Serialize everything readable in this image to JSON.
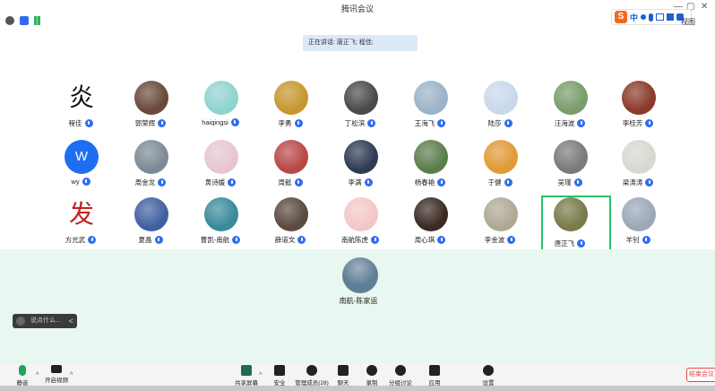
{
  "window": {
    "title": "腾讯会议",
    "controls": [
      "—",
      "▢",
      "✕"
    ]
  },
  "ime": {
    "logo": "S",
    "lang": "中",
    "tail": "视图"
  },
  "speaking_banner": "正在讲话: 唐正飞; 程佳;",
  "participants": [
    {
      "name": "程佳",
      "avatar": "calligraphy",
      "glyph": "炎",
      "color": "#ffffff"
    },
    {
      "name": "郭荣辉",
      "avatar": "photo",
      "color": "#6a4a3a"
    },
    {
      "name": "haiqingsi",
      "avatar": "photo",
      "color": "#8fd3d0"
    },
    {
      "name": "李勇",
      "avatar": "photo",
      "color": "#c7962f"
    },
    {
      "name": "丁松滨",
      "avatar": "photo",
      "color": "#4a4a4a"
    },
    {
      "name": "王海飞",
      "avatar": "photo",
      "color": "#9bb3c8"
    },
    {
      "name": "陆莎",
      "avatar": "photo",
      "color": "#c9d8ea"
    },
    {
      "name": "汪海波",
      "avatar": "photo",
      "color": "#7a9c6b"
    },
    {
      "name": "李桂芳",
      "avatar": "photo",
      "color": "#8a3a2a"
    },
    {
      "name": "wy",
      "avatar": "letter",
      "glyph": "W",
      "color": "#1e6ef2"
    },
    {
      "name": "周金龙",
      "avatar": "photo",
      "color": "#7d8a95"
    },
    {
      "name": "黄诗媛",
      "avatar": "photo",
      "color": "#e7c6cf"
    },
    {
      "name": "周懿",
      "avatar": "photo",
      "color": "#b84848"
    },
    {
      "name": "李满",
      "avatar": "photo",
      "color": "#2f3a55"
    },
    {
      "name": "杨春艳",
      "avatar": "photo",
      "color": "#5b7d4c"
    },
    {
      "name": "于健",
      "avatar": "photo",
      "color": "#e09a36"
    },
    {
      "name": "吴瑾",
      "avatar": "photo",
      "color": "#7a7a7a"
    },
    {
      "name": "梁涛涛",
      "avatar": "photo",
      "color": "#d8d8d0"
    },
    {
      "name": "方光武",
      "avatar": "calligraphy",
      "glyph": "发",
      "color": "#c42020"
    },
    {
      "name": "夏晶",
      "avatar": "photo",
      "color": "#4060a0"
    },
    {
      "name": "曹凯-南航",
      "avatar": "photo",
      "color": "#3a8a9a"
    },
    {
      "name": "薛道文",
      "avatar": "photo",
      "color": "#5a4a40"
    },
    {
      "name": "南航陈虎",
      "avatar": "photo",
      "color": "#f3c7c7"
    },
    {
      "name": "周心琪",
      "avatar": "photo",
      "color": "#3a2a22"
    },
    {
      "name": "李金波",
      "avatar": "photo",
      "color": "#b0a894"
    },
    {
      "name": "唐正飞",
      "avatar": "photo",
      "color": "#7a7a4a",
      "active": true
    },
    {
      "name": "羊钊",
      "avatar": "photo",
      "color": "#9aa8b8"
    }
  ],
  "self": {
    "name": "南航-陈家运",
    "color": "#5f7e95"
  },
  "chat_input": {
    "placeholder": "说点什么...",
    "chevron": "<"
  },
  "toolbar": {
    "mute": "静音",
    "video": "开启视频",
    "share": "共享屏幕",
    "security": "安全",
    "manage": "管理成员(28)",
    "chat": "聊天",
    "record": "录制",
    "breakout": "分组讨论",
    "apps": "应用",
    "settings": "设置",
    "end": "结束会议"
  }
}
